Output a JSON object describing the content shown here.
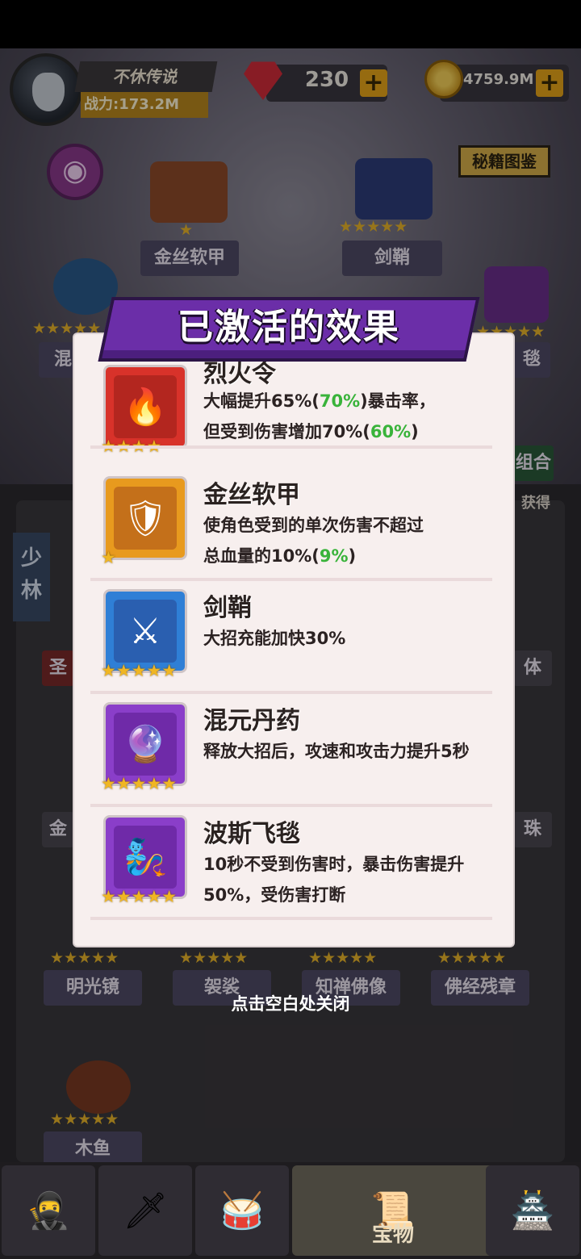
{
  "player": {
    "name": "不休传说",
    "power": "战力:173.2M"
  },
  "currency": {
    "gems": "230",
    "coins": "4759.9M",
    "plus": "+"
  },
  "icons": {
    "eye": "◉",
    "gem": "gem-icon",
    "coin": "coin-icon",
    "star": "★"
  },
  "codex_button": "秘籍图鉴",
  "background_items": {
    "row1": [
      "金丝软甲",
      "剑鞘"
    ],
    "row2_left": "混",
    "row2_right": "毯",
    "combo": "组合",
    "obtain": "获得",
    "sect_tag": "少林",
    "side_left_1": "圣",
    "side_right_1": "体",
    "side_left_2": "金",
    "side_right_2": "珠",
    "row3": [
      "明光镜",
      "袈裟",
      "知禅佛像",
      "佛经残章"
    ],
    "row4": [
      "木鱼"
    ]
  },
  "modal": {
    "title": "已激活的效果",
    "entries": [
      {
        "name": "烈火令",
        "desc_parts": [
          "大幅提升65%(",
          "70%",
          ")暴击率，",
          "但受到伤害增加70%(",
          "60%",
          ")"
        ],
        "stars": "★★★★",
        "color": "#d8322a"
      },
      {
        "name": "金丝软甲",
        "desc_parts": [
          "使角色受到的单次伤害不超过",
          "总血量的10%(",
          "9%",
          ")"
        ],
        "stars": "★",
        "color": "#e89a1e"
      },
      {
        "name": "剑鞘",
        "desc": "大招充能加快30%",
        "stars": "★★★★★",
        "color": "#2f7fd6"
      },
      {
        "name": "混元丹药",
        "desc": "释放大招后，攻速和攻击力提升5秒",
        "stars": "★★★★★",
        "color": "#8a3ec9"
      },
      {
        "name": "波斯飞毯",
        "desc": "10秒不受到伤害时，暴击伤害提升50%，受伤害打断",
        "stars": "★★★★★",
        "color": "#8a3ec9"
      }
    ]
  },
  "close_hint": "点击空白处关闭",
  "bottom_nav": {
    "active_label": "宝物"
  }
}
